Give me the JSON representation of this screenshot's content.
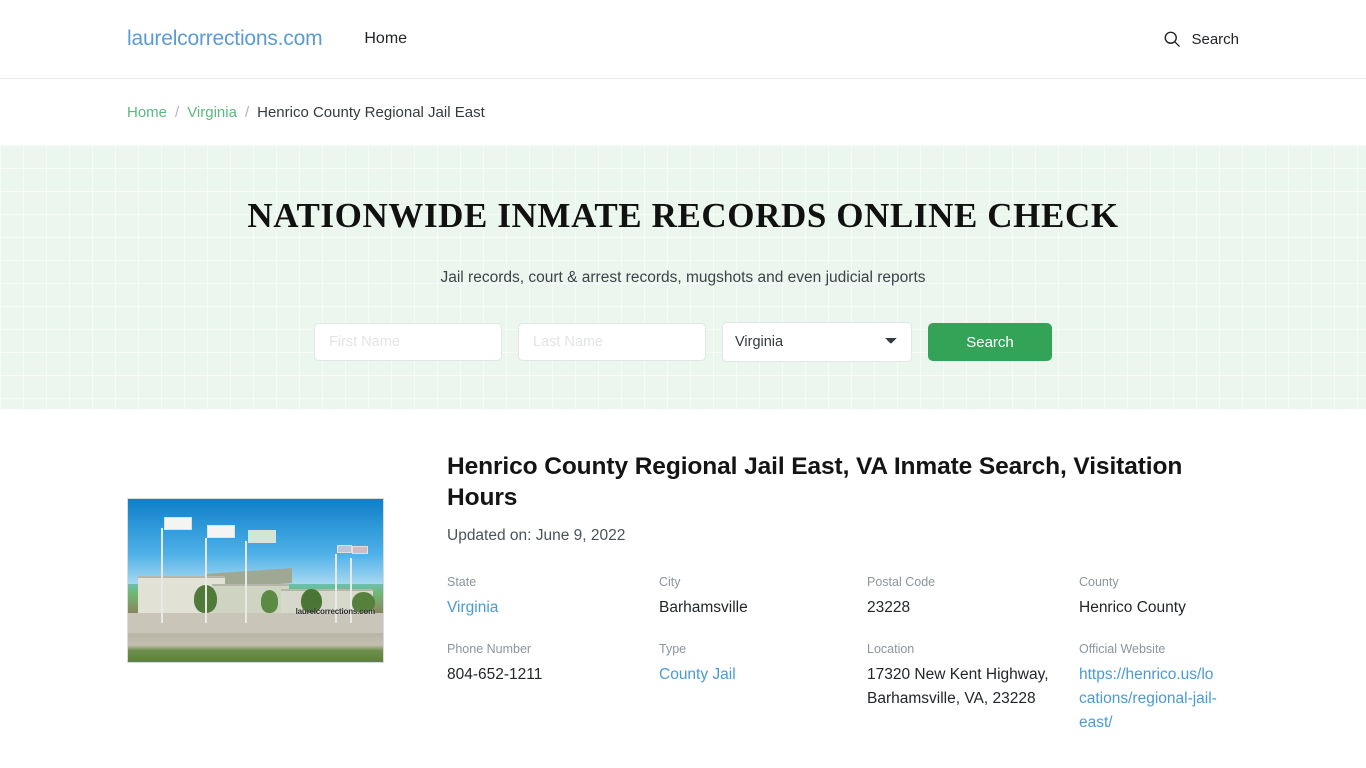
{
  "header": {
    "brand": "laurelcorrections.com",
    "nav": [
      {
        "label": "Home"
      }
    ],
    "search_label": "Search",
    "search_icon": "search-icon"
  },
  "breadcrumb": {
    "items": [
      {
        "label": "Home",
        "link": true
      },
      {
        "label": "Virginia",
        "link": true
      },
      {
        "label": "Henrico County Regional Jail East",
        "link": false
      }
    ],
    "separator": "/"
  },
  "hero": {
    "title": "NATIONWIDE INMATE RECORDS ONLINE CHECK",
    "subtitle": "Jail records, court & arrest records, mugshots and even judicial reports",
    "form": {
      "first_name_placeholder": "First Name",
      "first_name_value": "",
      "last_name_placeholder": "Last Name",
      "last_name_value": "",
      "state_selected": "Virginia",
      "state_options": [
        "Virginia"
      ],
      "submit_label": "Search"
    },
    "accent_color": "#33a457",
    "background_color": "#eaf6ee"
  },
  "article": {
    "title": "Henrico County Regional Jail East, VA Inmate Search, Visitation Hours",
    "updated": "Updated on: June 9, 2022",
    "photo": {
      "alt": "Henrico County Regional Jail East facility exterior",
      "watermark": "laurelcorrections.com"
    },
    "info": [
      {
        "label": "State",
        "value": "Virginia",
        "link": true
      },
      {
        "label": "City",
        "value": "Barhamsville",
        "link": false
      },
      {
        "label": "Postal Code",
        "value": "23228",
        "link": false
      },
      {
        "label": "County",
        "value": "Henrico County",
        "link": false
      },
      {
        "label": "Phone Number",
        "value": "804-652-1211",
        "link": false
      },
      {
        "label": "Type",
        "value": "County Jail",
        "link": true
      },
      {
        "label": "Location",
        "value": "17320 New Kent Highway, Barhamsville, VA, 23228",
        "link": false
      },
      {
        "label": "Official Website",
        "value": "https://henrico.us/locations/regional-jail-east/",
        "link": true
      }
    ]
  }
}
